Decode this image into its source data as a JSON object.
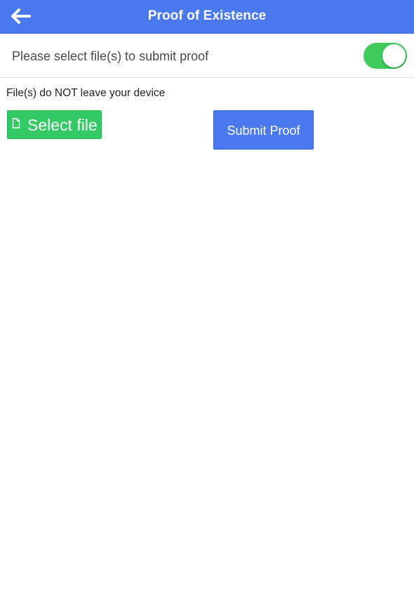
{
  "header": {
    "title": "Proof of Existence",
    "back_icon": "arrow-left-icon"
  },
  "toggle_row": {
    "label": "Please select file(s) to submit proof",
    "toggle_on": true,
    "toggle_color": "#3ecb5c"
  },
  "content": {
    "notice": "File(s) do NOT leave your device",
    "select_file_label": "Select file",
    "select_file_icon": "file-icon",
    "submit_label": "Submit Proof"
  },
  "colors": {
    "accent": "#4a78ef",
    "success": "#33c964"
  }
}
